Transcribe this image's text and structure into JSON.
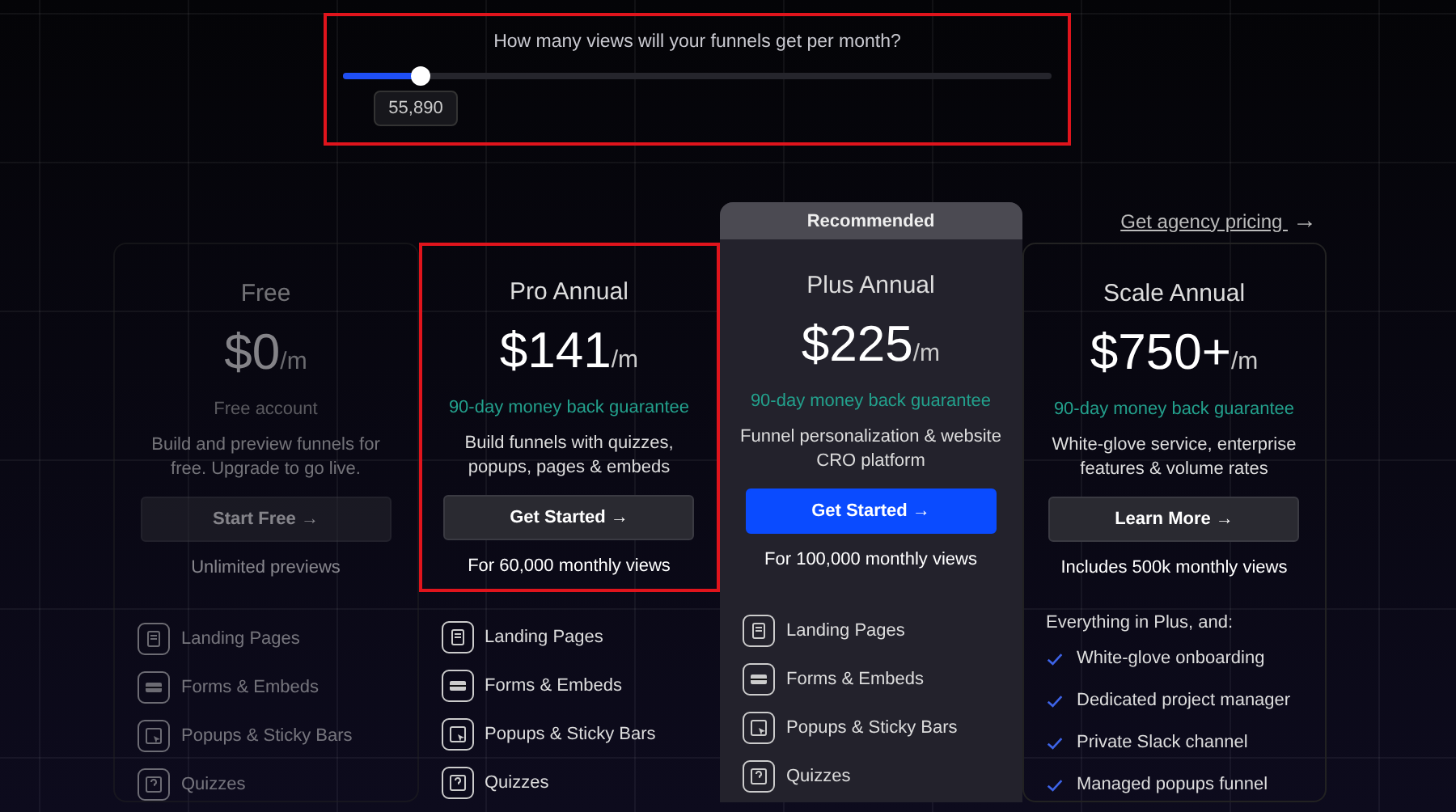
{
  "views_slider": {
    "question": "How many views will your funnels get per month?",
    "level": 0.11,
    "value": "55,890",
    "highlighted": true
  },
  "agency_link": {
    "label": "Get agency pricing",
    "icon": "→"
  },
  "plans": [
    {
      "name": "Free",
      "price": "$0",
      "unit": "/m",
      "subtitle": "Free account",
      "description": "Build and preview funnels for free. Upgrade to go live.",
      "button": "Start Free →",
      "primary": false,
      "views": "Unlimited previews",
      "dimmed": true,
      "highlighted": false,
      "features": [
        {
          "kind": "page",
          "label": "Landing Pages"
        },
        {
          "kind": "form",
          "label": "Forms & Embeds"
        },
        {
          "kind": "popup",
          "label": "Popups & Sticky Bars"
        },
        {
          "kind": "quiz",
          "label": "Quizzes"
        }
      ]
    },
    {
      "name": "Pro Annual",
      "price": "$141",
      "unit": "/m",
      "guarantee": "90-day money back guarantee",
      "description": "Build funnels with quizzes, popups, pages & embeds",
      "button": "Get Started →",
      "primary": false,
      "views": "For 60,000 monthly views",
      "dimmed": false,
      "highlighted": true,
      "features": [
        {
          "kind": "page",
          "label": "Landing Pages"
        },
        {
          "kind": "form",
          "label": "Forms & Embeds"
        },
        {
          "kind": "popup",
          "label": "Popups & Sticky Bars"
        },
        {
          "kind": "quiz",
          "label": "Quizzes"
        }
      ]
    },
    {
      "name": "Plus Annual",
      "price": "$225",
      "unit": "/m",
      "guarantee": "90-day money back guarantee",
      "description": "Funnel personalization & website CRO platform",
      "button": "Get Started →",
      "primary": true,
      "views": "For 100,000 monthly views",
      "dimmed": false,
      "highlighted": false,
      "recommended": "Recommended",
      "features": [
        {
          "kind": "page",
          "label": "Landing Pages"
        },
        {
          "kind": "form",
          "label": "Forms & Embeds"
        },
        {
          "kind": "popup",
          "label": "Popups & Sticky Bars"
        },
        {
          "kind": "quiz",
          "label": "Quizzes"
        }
      ]
    },
    {
      "name": "Scale Annual",
      "price": "$750+",
      "unit": "/m",
      "guarantee": "90-day money back guarantee",
      "description": "White-glove service, enterprise features & volume rates",
      "button": "Learn More →",
      "primary": false,
      "views": "Includes 500k monthly views",
      "dimmed": false,
      "highlighted": false,
      "features_heading": "Everything in Plus, and:",
      "features": [
        {
          "kind": "check",
          "label": "White-glove onboarding"
        },
        {
          "kind": "check",
          "label": "Dedicated project manager"
        },
        {
          "kind": "check",
          "label": "Private Slack channel"
        },
        {
          "kind": "check",
          "label": "Managed popups funnel"
        }
      ]
    }
  ]
}
